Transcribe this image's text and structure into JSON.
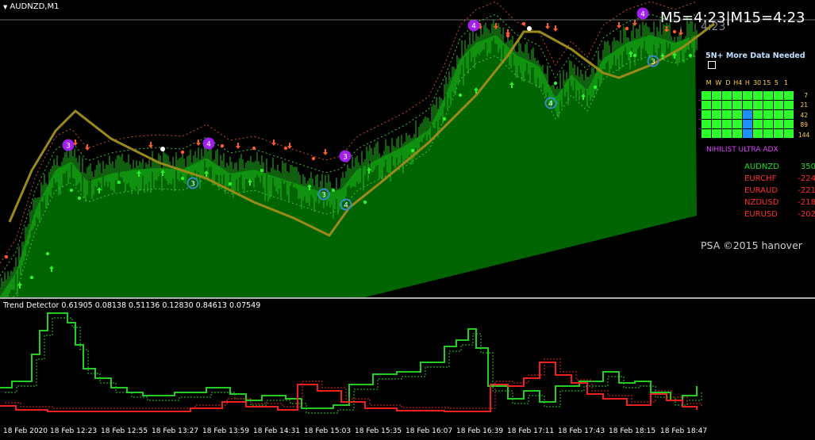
{
  "chart": {
    "symbol_title": "AUDNZD,M1",
    "timers": "M5=4:23|M15=4:23",
    "timers_shadow": "4:23",
    "data_needed": "5N+ More Data Needed",
    "data_needed_box": "...",
    "copyright": "PSA ©2015 hanover",
    "colors": {
      "background": "#000000",
      "area": "#006400",
      "bars": "#1fc01f",
      "ma": "#9a8a1a",
      "up_arrow": "#2ef02e",
      "down_arrow": "#ff5a2a",
      "badge_purple": "#a020f0",
      "badge_blue": "#3a88c8"
    }
  },
  "adx": {
    "headers": [
      "M",
      "W",
      "D",
      "H4",
      "H",
      "30",
      "15",
      "5",
      "1"
    ],
    "row_labels": [
      "7",
      "21",
      "42",
      "89",
      "144"
    ],
    "blue_cells": [
      [
        2,
        4
      ],
      [
        3,
        4
      ],
      [
        4,
        4
      ]
    ],
    "name": "NIHILIST ULTRA ADX"
  },
  "strength": [
    {
      "sym": "AUDNZD",
      "val": "350",
      "color": "#22dd22"
    },
    {
      "sym": "EURCHF",
      "val": "-224",
      "color": "#ff3030"
    },
    {
      "sym": "EURAUD",
      "val": "-221",
      "color": "#ff3030"
    },
    {
      "sym": "NZDUSD",
      "val": "-218",
      "color": "#ff3030"
    },
    {
      "sym": "EURUSD",
      "val": "-202",
      "color": "#ff3030"
    }
  ],
  "indicator": {
    "title": "Trend Detector 0.61905 0.08138 0.51136 0.12830 0.84613 0.07549",
    "colors": {
      "up": "#22cc22",
      "down": "#ee2020"
    }
  },
  "time_axis": [
    "18 Feb 2020",
    "18 Feb 12:23",
    "18 Feb 12:55",
    "18 Feb 13:27",
    "18 Feb 13:59",
    "18 Feb 14:31",
    "18 Feb 15:03",
    "18 Feb 15:35",
    "18 Feb 16:07",
    "18 Feb 16:39",
    "18 Feb 17:11",
    "18 Feb 17:43",
    "18 Feb 18:15",
    "18 Feb 18:47"
  ],
  "badges": [
    {
      "text": "3",
      "kind": "purple"
    },
    {
      "text": "4",
      "kind": "purple"
    },
    {
      "text": "3",
      "kind": "purple"
    },
    {
      "text": "4",
      "kind": "purple"
    },
    {
      "text": "4",
      "kind": "purple"
    },
    {
      "text": "3",
      "kind": "blue"
    },
    {
      "text": "3",
      "kind": "blue"
    },
    {
      "text": "4",
      "kind": "blue"
    },
    {
      "text": "4",
      "kind": "blue"
    },
    {
      "text": "3",
      "kind": "blue"
    }
  ]
}
